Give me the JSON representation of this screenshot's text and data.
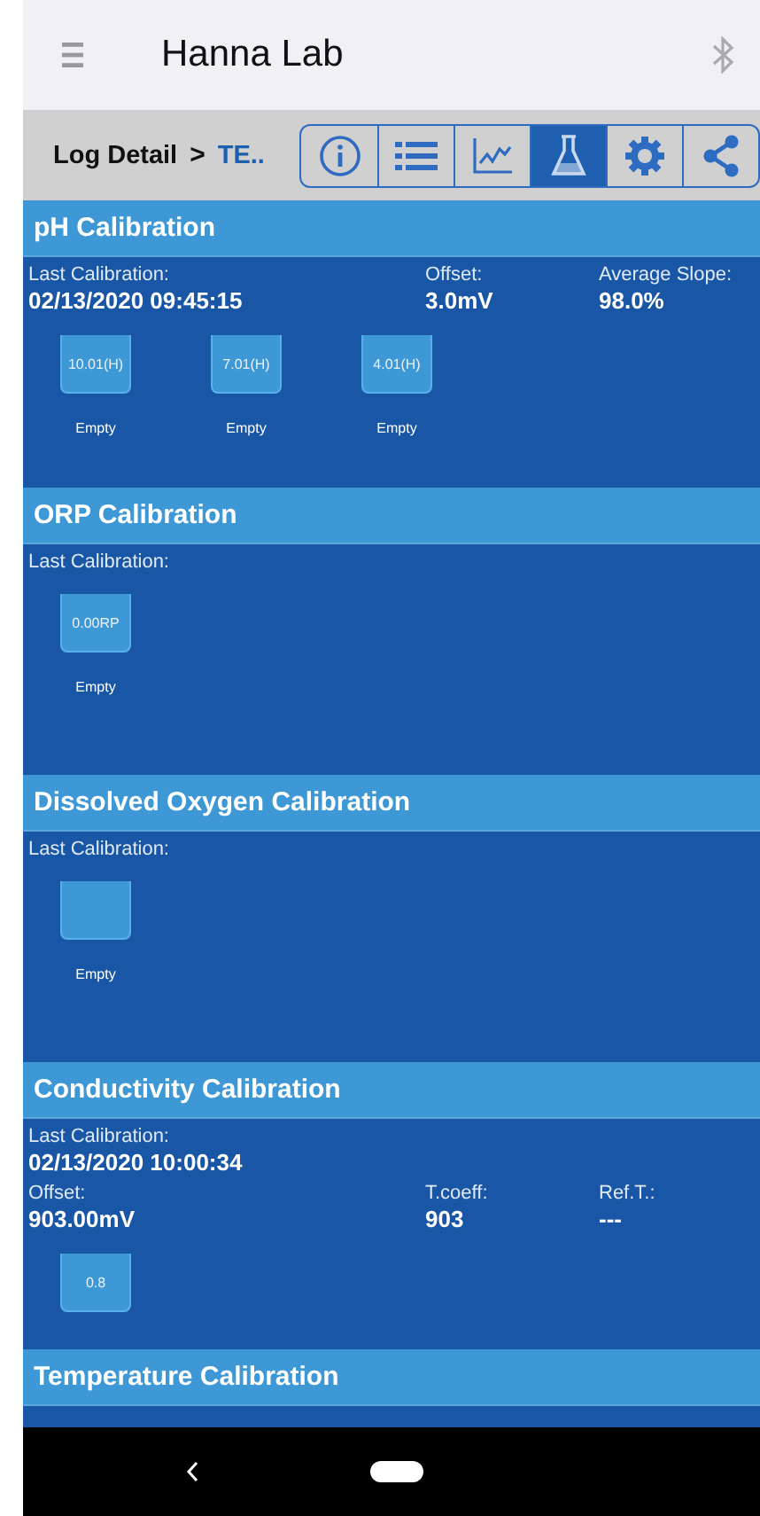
{
  "app_bar": {
    "title": "Hanna Lab"
  },
  "breadcrumb": {
    "parent": "Log Detail",
    "separator": ">",
    "current": "TE.."
  },
  "tabs": [
    {
      "kind": "info",
      "selected": false
    },
    {
      "kind": "list",
      "selected": false
    },
    {
      "kind": "chart",
      "selected": false
    },
    {
      "kind": "flask",
      "selected": true
    },
    {
      "kind": "gear",
      "selected": false
    },
    {
      "kind": "share",
      "selected": false
    }
  ],
  "sections": [
    {
      "title": "pH Calibration",
      "rows": [
        [
          {
            "label": "Last Calibration:",
            "value": "02/13/2020 09:45:15"
          },
          {
            "label": "Offset:",
            "value": "3.0mV"
          },
          {
            "label": "Average Slope:",
            "value": "98.0%"
          }
        ]
      ],
      "beakers": [
        {
          "label": "10.01(H)",
          "caption": "Empty"
        },
        {
          "label": "7.01(H)",
          "caption": "Empty"
        },
        {
          "label": "4.01(H)",
          "caption": "Empty"
        }
      ]
    },
    {
      "title": "ORP Calibration",
      "rows": [
        [
          {
            "label": "Last Calibration:"
          }
        ]
      ],
      "beakers": [
        {
          "label": "0.00RP",
          "caption": "Empty"
        }
      ]
    },
    {
      "title": "Dissolved Oxygen Calibration",
      "rows": [
        [
          {
            "label": "Last Calibration:"
          }
        ]
      ],
      "beakers": [
        {
          "caption": "Empty"
        }
      ]
    },
    {
      "title": "Conductivity Calibration",
      "rows": [
        [
          {
            "label": "Last Calibration:",
            "value": "02/13/2020 10:00:34"
          }
        ],
        [
          {
            "label": "Offset:",
            "value": "903.00mV"
          },
          {
            "label": "T.coeff:",
            "value": "903"
          },
          {
            "label": "Ref.T.:",
            "value": "---"
          }
        ]
      ],
      "beakers": [
        {
          "label": "0.8"
        }
      ]
    },
    {
      "title": "Temperature Calibration"
    }
  ]
}
